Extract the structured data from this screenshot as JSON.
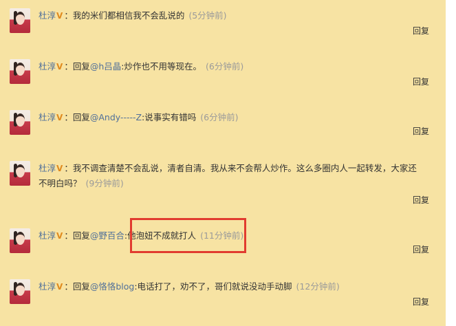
{
  "reply_label": "回复",
  "comments": [
    {
      "author": "杜淳",
      "vip_mark": "V",
      "colon": "：",
      "prefix": "",
      "mention": "",
      "text": "我的米们都相信我不会乱说的",
      "time": "(5分钟前)"
    },
    {
      "author": "杜淳",
      "vip_mark": "V",
      "colon": "：",
      "prefix": "回复",
      "mention": "@h吕晶",
      "text": ":炒作也不用等现在。",
      "time": "(6分钟前)"
    },
    {
      "author": "杜淳",
      "vip_mark": "V",
      "colon": "：",
      "prefix": "回复",
      "mention": "@Andy-----Z",
      "text": ":说事实有错吗",
      "time": "(6分钟前)"
    },
    {
      "author": "杜淳",
      "vip_mark": "V",
      "colon": "：",
      "prefix": "",
      "mention": "",
      "text": "我不调查清楚不会乱说，清者自清。我从来不会帮人炒作。这么多圈内人一起转发，大家还不明白吗？",
      "time": "(9分钟前)"
    },
    {
      "author": "杜淳",
      "vip_mark": "V",
      "colon": "：",
      "prefix": "回复",
      "mention": "@野百合",
      "text": ":他泡妞不成就打人",
      "time": "(11分钟前)"
    },
    {
      "author": "杜淳",
      "vip_mark": "V",
      "colon": "：",
      "prefix": "回复",
      "mention": "@恪恪blog",
      "text": ":电话打了，劝不了，哥们就说没动手动脚",
      "time": "(12分钟前)"
    }
  ],
  "colors": {
    "background": "#f7e3a3",
    "link": "#4f6f9a",
    "vip": "#e08a1e",
    "highlight_box": "#e13b2f"
  }
}
